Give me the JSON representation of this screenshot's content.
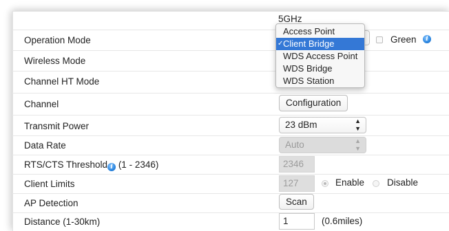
{
  "band_header": "5GHz",
  "rows": {
    "operation_mode": "Operation Mode",
    "wireless_mode": "Wireless Mode",
    "channel_ht_mode": "Channel HT Mode",
    "channel": "Channel",
    "transmit_power": "Transmit Power",
    "data_rate": "Data Rate",
    "rts_cts": "RTS/CTS Threshold",
    "rts_cts_range": "(1 - 2346)",
    "client_limits": "Client Limits",
    "ap_detection": "AP Detection",
    "distance": "Distance (1-30km)"
  },
  "operation_mode_dropdown": {
    "options": [
      "Access Point",
      "Client Bridge",
      "WDS Access Point",
      "WDS Bridge",
      "WDS Station"
    ],
    "selected": "Client Bridge"
  },
  "green": {
    "label": "Green",
    "checked": false
  },
  "channel_button": "Configuration",
  "transmit_power_value": "23 dBm",
  "data_rate_value": "Auto",
  "rts_cts_value": "2346",
  "client_limits": {
    "value": "127",
    "enable_label": "Enable",
    "disable_label": "Disable",
    "selected": "Enable"
  },
  "scan_button": "Scan",
  "distance": {
    "value": "1",
    "note": "(0.6miles)"
  },
  "icons": {
    "info": "info-icon",
    "checkmark": "checkmark-icon",
    "select_arrows": "updown-arrows-icon"
  },
  "colors": {
    "selection_blue": "#3478d6",
    "info_blue": "#2a86e0"
  }
}
